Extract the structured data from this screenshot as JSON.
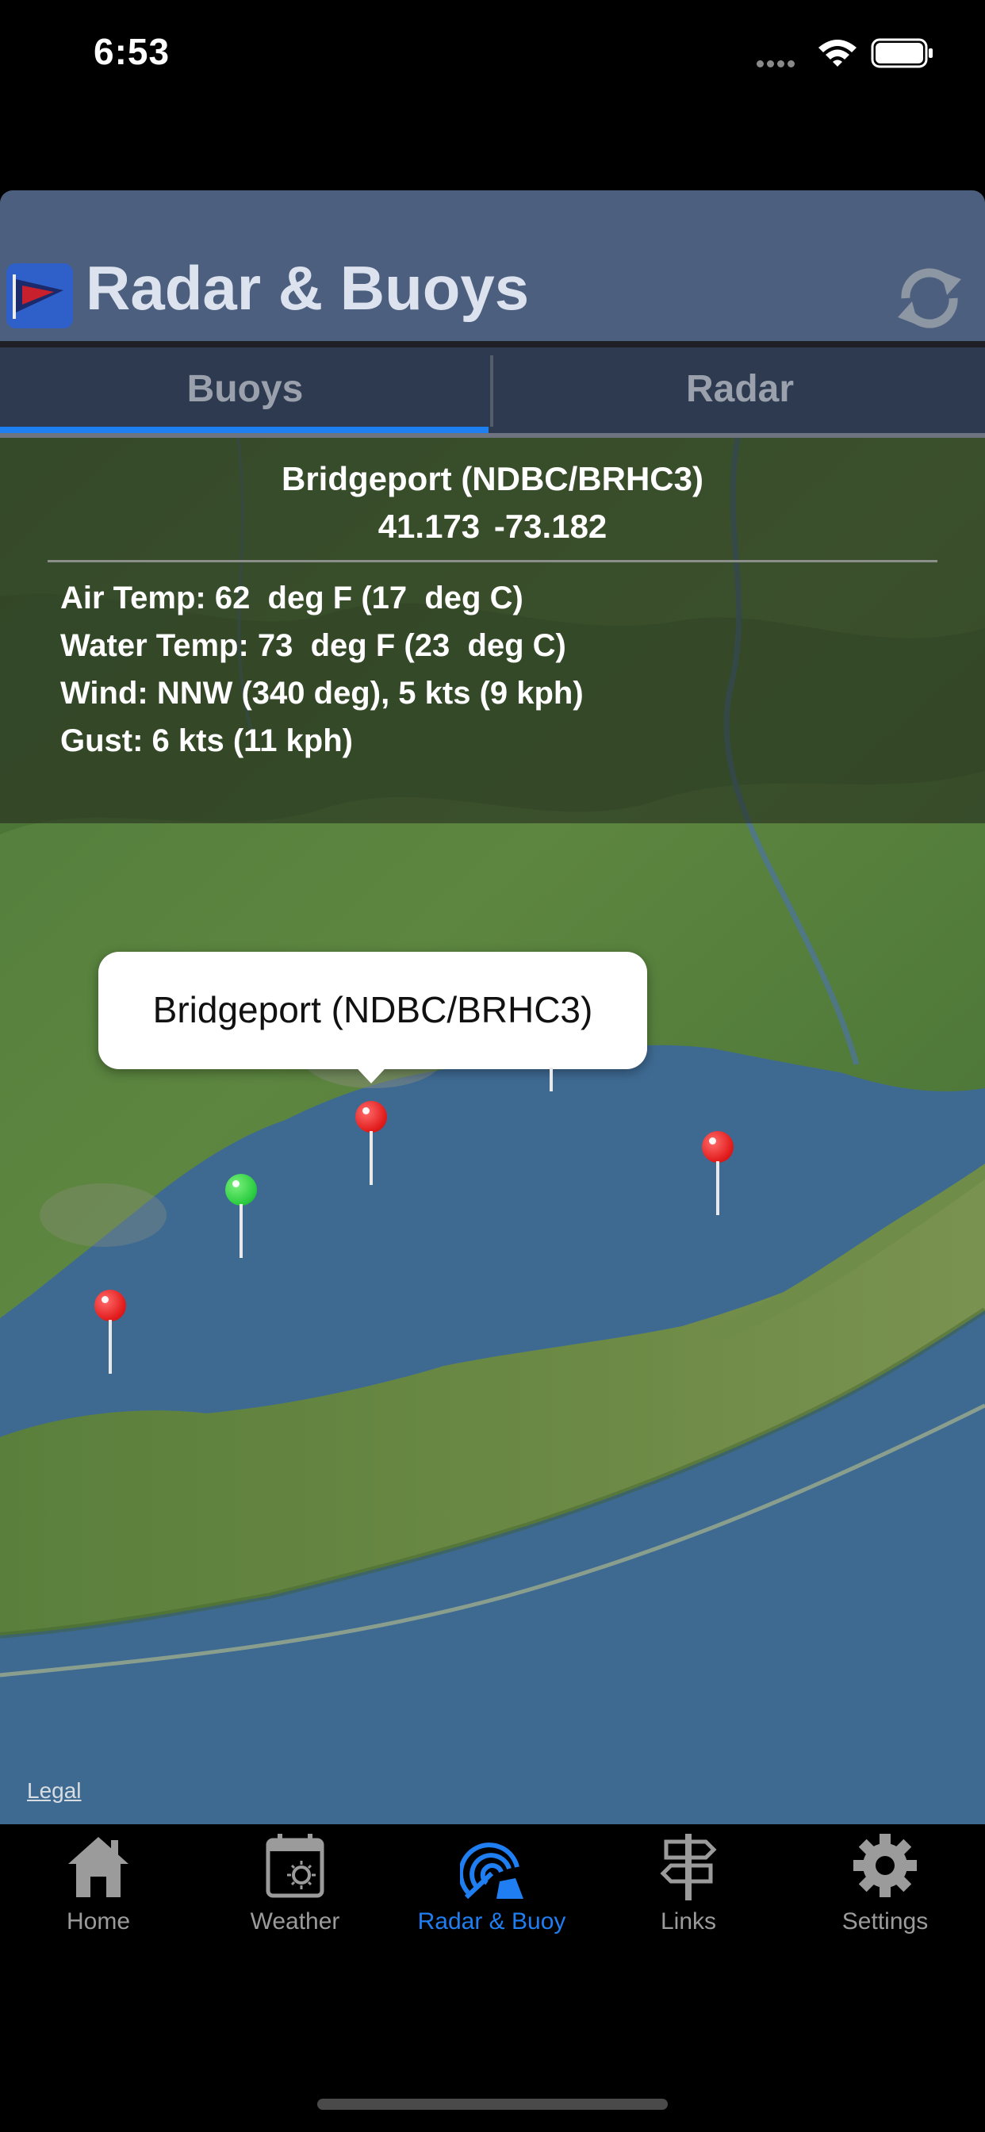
{
  "status_bar": {
    "time": "6:53"
  },
  "header": {
    "title": "Radar & Buoys"
  },
  "tabs": [
    {
      "label": "Buoys"
    },
    {
      "label": "Radar"
    }
  ],
  "station": {
    "name": "Bridgeport (NDBC/BRHC3)",
    "coords": "41.173  -73.182",
    "readings": [
      "Air Temp: 62  deg F (17  deg C)",
      "Water Temp: 73  deg F (23  deg C)",
      "Wind: NNW (340 deg), 5 kts (9 kph)",
      "Gust: 6 kts (11 kph)"
    ]
  },
  "map": {
    "callout_label": "Bridgeport (NDBC/BRHC3)",
    "legal": "Legal",
    "pin_colors": {
      "red": "#e21d1d",
      "green": "#2ccd42"
    }
  },
  "tab_bar": {
    "items": [
      {
        "label": "Home",
        "icon": "home-icon"
      },
      {
        "label": "Weather",
        "icon": "weather-icon"
      },
      {
        "label": "Radar & Buoy",
        "icon": "radar-icon"
      },
      {
        "label": "Links",
        "icon": "signpost-icon"
      },
      {
        "label": "Settings",
        "icon": "gear-icon"
      }
    ],
    "active_color": "#1f7ef2"
  }
}
